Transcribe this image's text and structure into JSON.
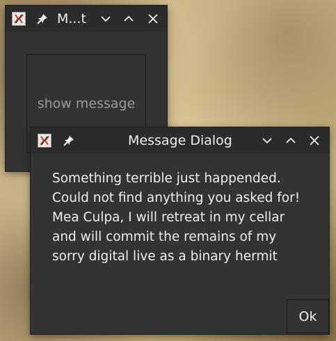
{
  "main_window": {
    "title": "M...t",
    "app_icon": "x11-app-icon",
    "pin_icon": "pin-icon",
    "show_button_label": "show message"
  },
  "dialog": {
    "title": "Message Dialog",
    "app_icon": "x11-app-icon",
    "pin_icon": "pin-icon",
    "message": "Something terrible just happended.\nCould not find anything you asked for!\nMea Culpa, I will retreat in my cellar\nand will commit the remains of my\nsorry digital live as a binary hermit",
    "ok_label": "Ok"
  },
  "colors": {
    "window_bg": "#333333",
    "titlebar_bg": "#2b2b2b",
    "text": "#eeeeee",
    "muted_text": "#9a9a9a"
  }
}
